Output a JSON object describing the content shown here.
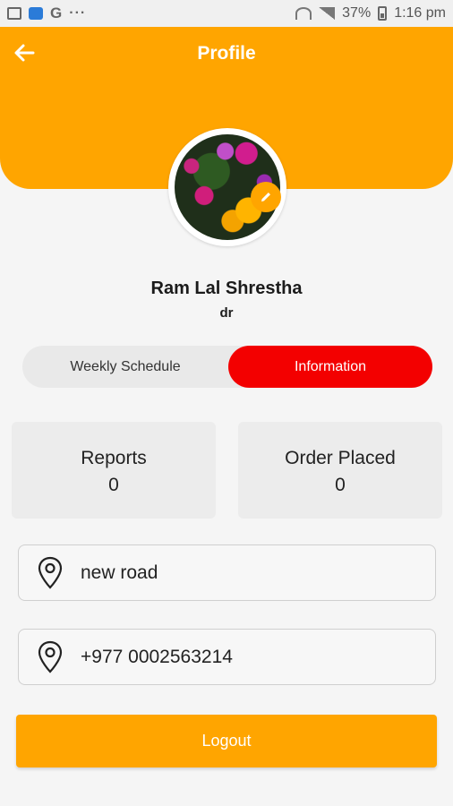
{
  "status_bar": {
    "google_letter": "G",
    "more_dots": "···",
    "battery_percent": "37%",
    "time": "1:16 pm"
  },
  "header": {
    "title": "Profile",
    "back_icon": "arrow-left-icon",
    "color": "#ffa500"
  },
  "profile": {
    "name": "Ram Lal Shrestha",
    "role": "dr",
    "edit_icon": "pencil-icon"
  },
  "tabs": [
    {
      "label": "Weekly Schedule",
      "active": false
    },
    {
      "label": "Information",
      "active": true
    }
  ],
  "stats": [
    {
      "label": "Reports",
      "value": "0"
    },
    {
      "label": "Order Placed",
      "value": "0"
    }
  ],
  "info": {
    "address": "new road",
    "phone": "+977 0002563214",
    "icon": "location-pin-icon"
  },
  "logout": {
    "label": "Logout"
  },
  "colors": {
    "accent": "#ffa500",
    "active_tab": "#f30000"
  }
}
